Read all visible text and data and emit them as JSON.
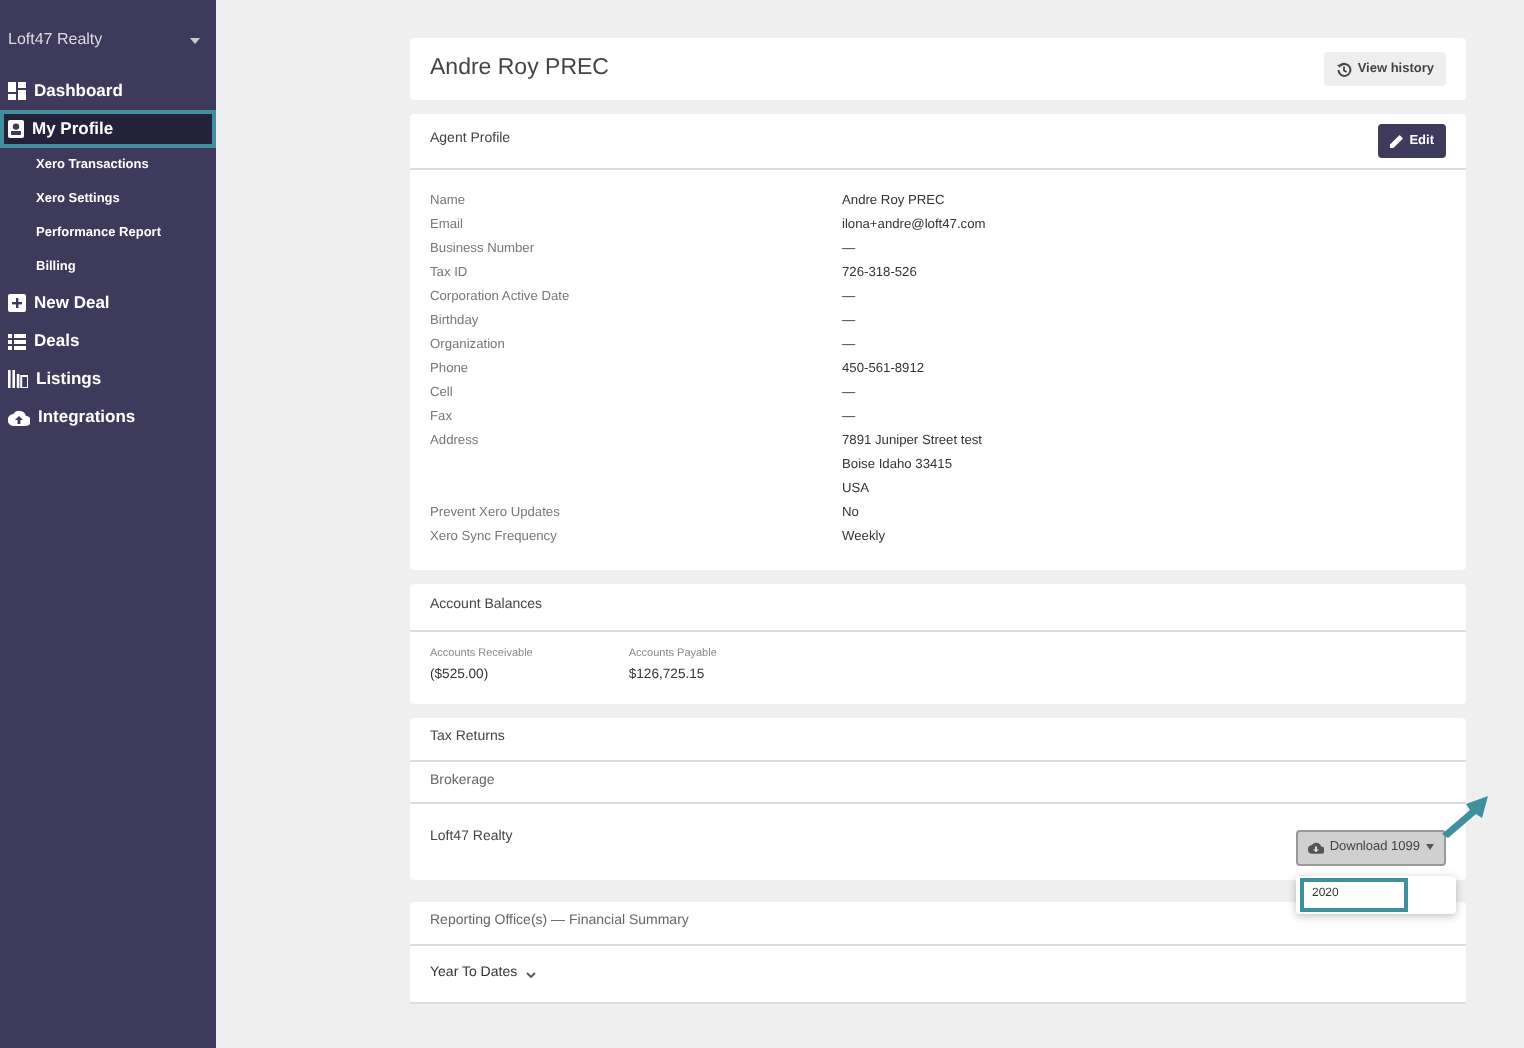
{
  "sidebar": {
    "org": "Loft47 Realty",
    "items": [
      {
        "label": "Dashboard",
        "kind": "main",
        "selected": false,
        "highlighted": false
      },
      {
        "label": "My Profile",
        "kind": "main",
        "selected": true,
        "highlighted": true
      },
      {
        "label": "Xero Transactions",
        "kind": "sub",
        "selected": false,
        "highlighted": false
      },
      {
        "label": "Xero Settings",
        "kind": "sub",
        "selected": false,
        "highlighted": false
      },
      {
        "label": "Performance Report",
        "kind": "sub",
        "selected": false,
        "highlighted": false
      },
      {
        "label": "Billing",
        "kind": "sub",
        "selected": false,
        "highlighted": false
      },
      {
        "label": "New Deal",
        "kind": "main",
        "selected": false,
        "highlighted": false
      },
      {
        "label": "Deals",
        "kind": "main",
        "selected": false,
        "highlighted": false
      },
      {
        "label": "Listings",
        "kind": "main",
        "selected": false,
        "highlighted": false
      },
      {
        "label": "Integrations",
        "kind": "main",
        "selected": false,
        "highlighted": false
      }
    ]
  },
  "header": {
    "title": "Andre Roy PREC",
    "button": "View history"
  },
  "agent_profile": {
    "title": "Agent Profile",
    "button": "Edit",
    "fields": [
      {
        "label": "Name",
        "values": [
          "Andre Roy PREC"
        ]
      },
      {
        "label": "Email",
        "values": [
          "ilona+andre@loft47.com"
        ]
      },
      {
        "label": "Business Number",
        "values": [
          "—"
        ]
      },
      {
        "label": "Tax ID",
        "values": [
          "726-318-526"
        ]
      },
      {
        "label": "Corporation Active Date",
        "values": [
          "—"
        ]
      },
      {
        "label": "Birthday",
        "values": [
          "—"
        ]
      },
      {
        "label": "Organization",
        "values": [
          "—"
        ]
      },
      {
        "label": "Phone",
        "values": [
          "450-561-8912"
        ]
      },
      {
        "label": "Cell",
        "values": [
          "—"
        ]
      },
      {
        "label": "Fax",
        "values": [
          "—"
        ]
      },
      {
        "label": "Address",
        "values": [
          "7891 Juniper Street test",
          "Boise Idaho 33415",
          "USA"
        ]
      },
      {
        "label": "Prevent Xero Updates",
        "values": [
          "No"
        ]
      },
      {
        "label": "Xero Sync Frequency",
        "values": [
          "Weekly"
        ]
      }
    ]
  },
  "account_balances": {
    "title": "Account Balances",
    "items": [
      {
        "label": "Accounts Receivable",
        "value": "($525.00)"
      },
      {
        "label": "Accounts Payable",
        "value": "$126,725.15"
      }
    ]
  },
  "tax_returns": {
    "title": "Tax Returns",
    "section": "Brokerage",
    "row": "Loft47 Realty",
    "download": {
      "label": "Download 1099",
      "expanded": true,
      "menu": [
        {
          "label": "2020",
          "highlighted": true
        }
      ]
    }
  },
  "financial_summary": {
    "title": "Reporting Office(s) — Financial Summary",
    "filter": "Year To Dates"
  }
}
